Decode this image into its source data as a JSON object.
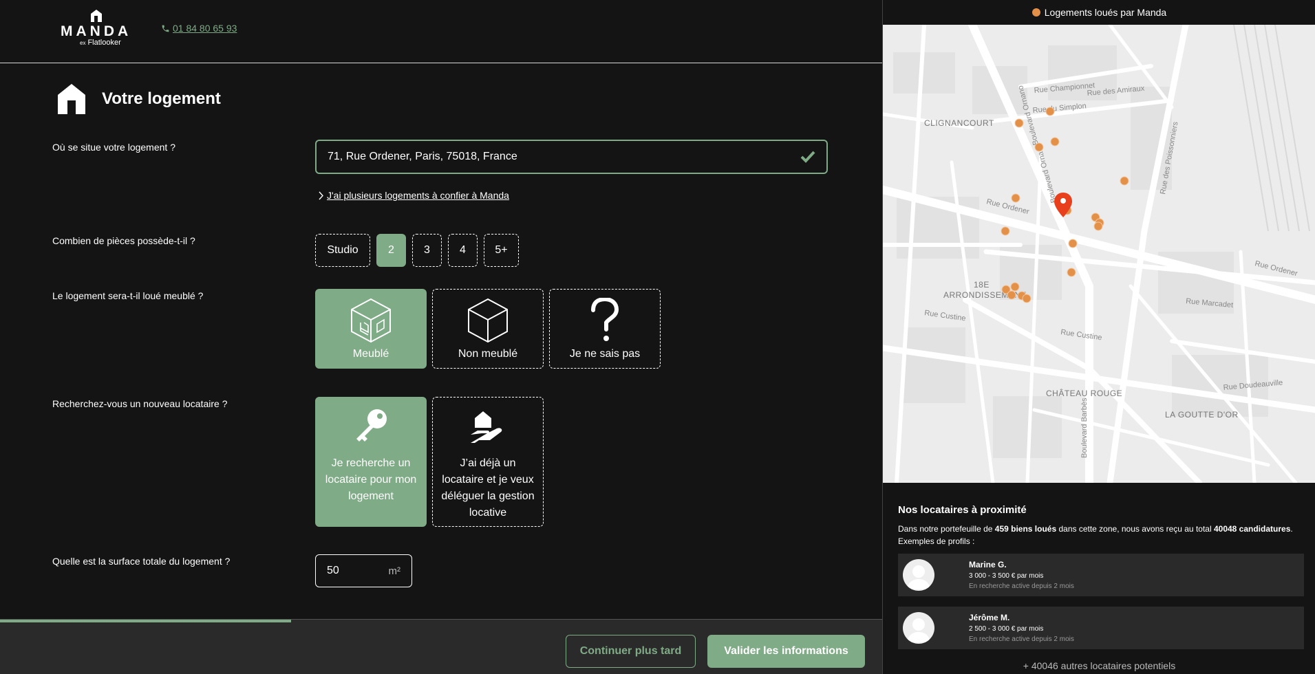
{
  "header": {
    "brand": "MANDA",
    "brand_prefix": "ex",
    "brand_sub": "Flatlooker",
    "phone": "01 84 80 65 93"
  },
  "section": {
    "title": "Votre logement"
  },
  "questions": {
    "location": "Où se situe votre logement ?",
    "rooms": "Combien de pièces possède-t-il ?",
    "furnished": "Le logement sera-t-il loué meublé ?",
    "tenant": "Recherchez-vous un nouveau locataire ?",
    "surface": "Quelle est la surface totale du logement ?"
  },
  "address": {
    "value": "71, Rue Ordener, Paris, 75018, France"
  },
  "multi_link": "J'ai plusieurs logements à confier à Manda",
  "rooms": {
    "options": [
      "Studio",
      "2",
      "3",
      "4",
      "5+"
    ],
    "selected": "2"
  },
  "furnished": {
    "options": [
      "Meublé",
      "Non meublé",
      "Je ne sais pas"
    ],
    "selected": "Meublé"
  },
  "tenant_search": {
    "options": [
      "Je recherche un locataire pour mon logement",
      "J’ai déjà un locataire et je veux déléguer la gestion locative"
    ],
    "selected": "Je recherche un locataire pour mon logement"
  },
  "surface": {
    "value": "50",
    "unit": "m²"
  },
  "footer": {
    "progress": 0.33,
    "later": "Continuer plus tard",
    "validate": "Valider les informations"
  },
  "map": {
    "legend": "Logements loués par Manda",
    "labels": {
      "clignancourt": "CLIGNANCOURT",
      "arr1": "18E",
      "arr2": "ARRONDISSEMENT",
      "chateau": "CHÂTEAU ROUGE",
      "goutte": "LA GOUTTE D'OR",
      "ornano": "Boulevard Ornano",
      "barbes": "Boulevard Barbès",
      "ordener1": "Rue Ordener",
      "ordener2": "Rue Ordener",
      "poissonniers": "Rue des Poissonniers",
      "custine1": "Rue Custine",
      "custine2": "Rue Custine",
      "doudeauville": "Rue Doudeauville",
      "marcadet": "Rue Marcadet",
      "championnet": "Rue Championnet",
      "simplon": "Rue du Simplon",
      "amiraux": "Rue des Amiraux"
    }
  },
  "nearby": {
    "title": "Nos locataires à proximité",
    "text_a": "Dans notre portefeuille de ",
    "count_props": "459 biens loués",
    "text_b": " dans cette zone, nous avons reçu au total ",
    "count_apps": "40048 candidatures",
    "text_c": ".",
    "text_d": "Exemples de profils :",
    "tenants": [
      {
        "name": "Marine G.",
        "budget": "3 000 - 3 500 € par mois",
        "since": "En recherche active depuis 2 mois"
      },
      {
        "name": "Jérôme M.",
        "budget": "2 500 - 3 000 € par mois",
        "since": "En recherche active depuis 2 mois"
      }
    ],
    "more": "+ 40046 autres locataires potentiels"
  },
  "colors": {
    "accent": "#7fab86",
    "marker": "#e39049",
    "pin": "#e8401c"
  }
}
